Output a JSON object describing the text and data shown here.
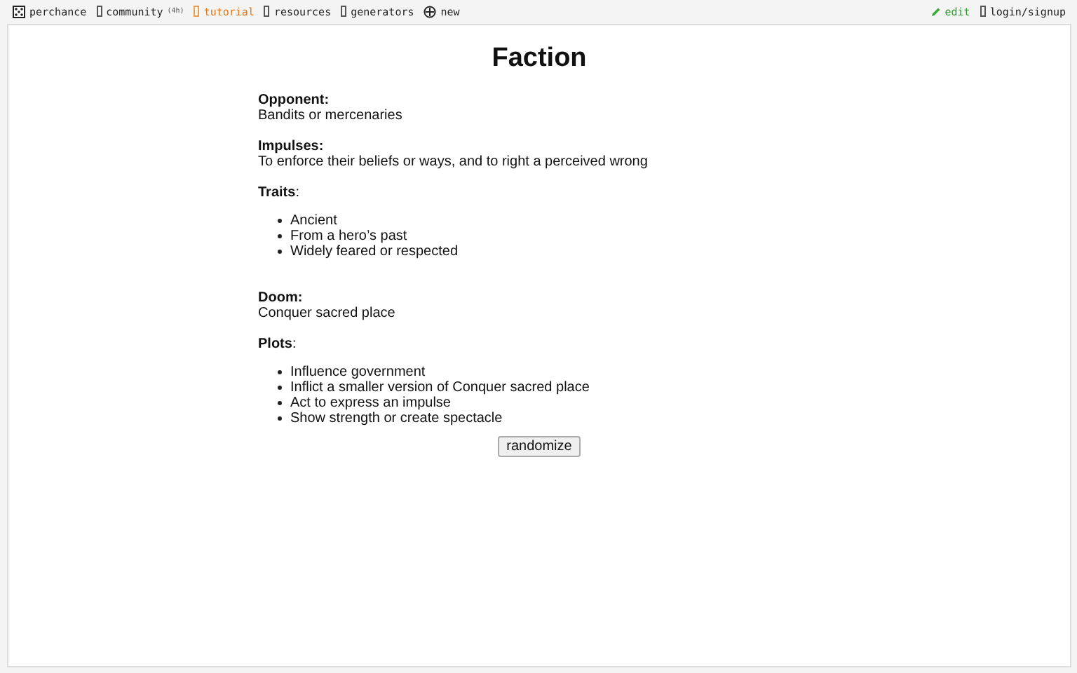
{
  "nav": {
    "left": [
      {
        "kind": "dice",
        "label": "perchance"
      },
      {
        "kind": "box",
        "label": "community",
        "badge": "(4h)"
      },
      {
        "kind": "box",
        "label": "tutorial",
        "highlight": true
      },
      {
        "kind": "box",
        "label": "resources"
      },
      {
        "kind": "box",
        "label": "generators"
      },
      {
        "kind": "plus",
        "label": "new"
      }
    ],
    "right": [
      {
        "kind": "pencil",
        "label": "edit"
      },
      {
        "kind": "box",
        "label": "login/signup"
      }
    ]
  },
  "title": "Faction",
  "sections": [
    {
      "label": "Opponent:",
      "text": "Bandits or mercenaries"
    },
    {
      "label": "Impulses:",
      "text": "To enforce their beliefs or ways, and to right a perceived wrong"
    },
    {
      "label": "**Traits**:",
      "items": [
        "Ancient",
        "From a hero’s past",
        "Widely feared or respected"
      ]
    },
    {
      "label": "Doom:",
      "text": "Conquer sacred place"
    },
    {
      "label": "**Plots**:",
      "items": [
        "Influence government",
        "Inflict a smaller version of Conquer sacred place",
        "Act to express an impulse",
        "Show strength or create spectacle"
      ]
    }
  ],
  "button": "randomize"
}
